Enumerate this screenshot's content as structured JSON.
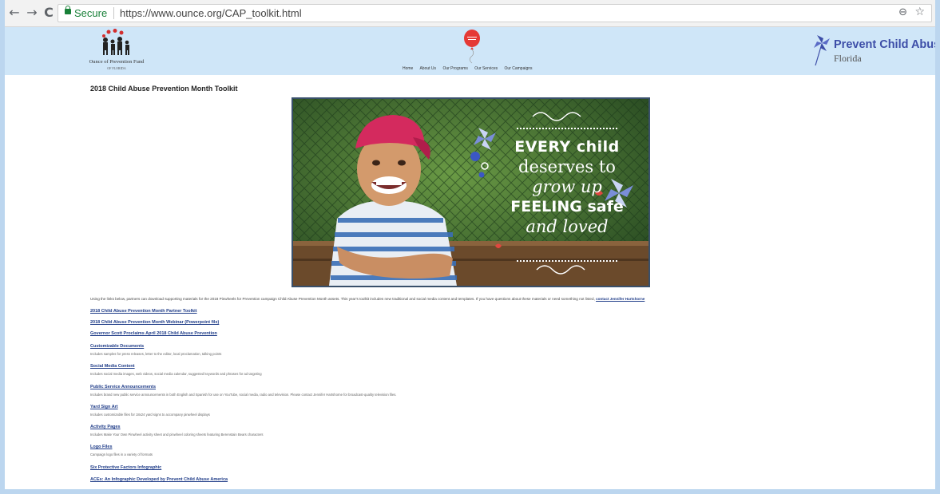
{
  "browser": {
    "secure_label": "Secure",
    "url": "https://www.ounce.org/CAP_toolkit.html",
    "back": "←",
    "forward": "→",
    "reload": "C"
  },
  "header": {
    "ounce_name": "Ounce of Prevention Fund",
    "ounce_sub": "OF FLORIDA",
    "nav": [
      "Home",
      "About Us",
      "Our Programs",
      "Our Services",
      "Our Campaigns"
    ],
    "pca_title": "Prevent Child Abuse",
    "pca_sub": "Florida"
  },
  "page": {
    "title": "2018 Child Abuse Prevention Month Toolkit"
  },
  "hero": {
    "line1": "EVERY child",
    "line2": "deserves to",
    "line3": "grow up",
    "line4": "FEELING safe",
    "line5": "and loved"
  },
  "intro": {
    "text": "Using the links below, partners can download supporting materials for the 2018 Pinwheels for Prevention campaign Child Abuse Prevention Month assets. This year's toolkit includes new traditional and social media content and templates. If you have questions about these materials or need something not listed,",
    "contact": "contact Jennifer Hartshorne"
  },
  "items": [
    {
      "link": "2018 Child Abuse Prevention Month Partner Toolkit",
      "desc": ""
    },
    {
      "link": "2018 Child Abuse Prevention Month Webinar (Powerpoint file)",
      "desc": ""
    },
    {
      "link": "Governor Scott Proclaims April 2018 Child Abuse Prevention",
      "desc": ""
    },
    {
      "link": "Customizable Documents",
      "desc": "Includes samples for press releases, letter to the editor, local proclamation, talking points"
    },
    {
      "link": "Social Media Content",
      "desc": "Includes social media images, web videos, social media calendar, suggested keywords and phrases for ad targeting"
    },
    {
      "link": "Public Service Announcements",
      "desc": "Includes brand new public service announcements in both English and Spanish for use on YouTube, social media, radio and television. Please contact Jennifer Hartshorne for broadcast-quality television files."
    },
    {
      "link": "Yard Sign Art",
      "desc": "Includes customizable files for 18x24 yard signs to accompany pinwheel displays"
    },
    {
      "link": "Activity Pages",
      "desc": "Includes Make Your Own Pinwheel activity sheet and pinwheel coloring sheets featuring Berenstain Bears characters"
    },
    {
      "link": "Logo Files",
      "desc": "Campaign logo files in a variety of formats"
    },
    {
      "link": "Six Protective Factors Infographic",
      "desc": ""
    },
    {
      "link": "ACEs: An Infographic Developed by Prevent Child Abuse America",
      "desc": ""
    }
  ]
}
